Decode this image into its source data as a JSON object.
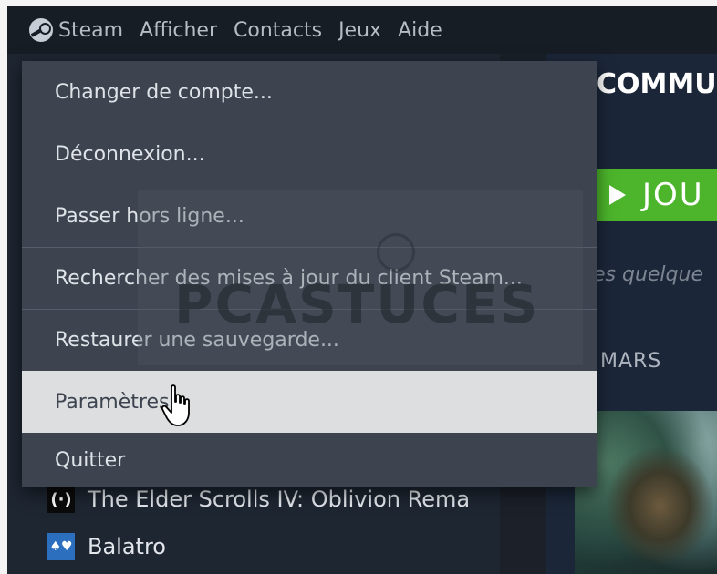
{
  "menubar": {
    "items": [
      "Steam",
      "Afficher",
      "Contacts",
      "Jeux",
      "Aide"
    ]
  },
  "dropdown": {
    "items": [
      "Changer de compte...",
      "Déconnexion...",
      "Passer hors ligne...",
      "Rechercher des mises à jour du client Steam...",
      "Restaurer une sauvegarde...",
      "Paramètres",
      "Quitter"
    ],
    "highlighted": "Paramètres"
  },
  "library": {
    "games": [
      "The Elder Scrolls IV: Oblivion Rema",
      "Balatro"
    ],
    "icons": [
      "oblivion-icon",
      "balatro-icon"
    ]
  },
  "main": {
    "title": "COMMU",
    "play_label": "JOU",
    "teaser": "es quelque",
    "month": "MARS"
  },
  "watermark": {
    "text": "PCASTUCES"
  },
  "colors": {
    "menu_bg": "#3d4450",
    "menu_hover": "#dcdedf",
    "play_green": "#4cb52b",
    "app_bg": "#171d25"
  }
}
